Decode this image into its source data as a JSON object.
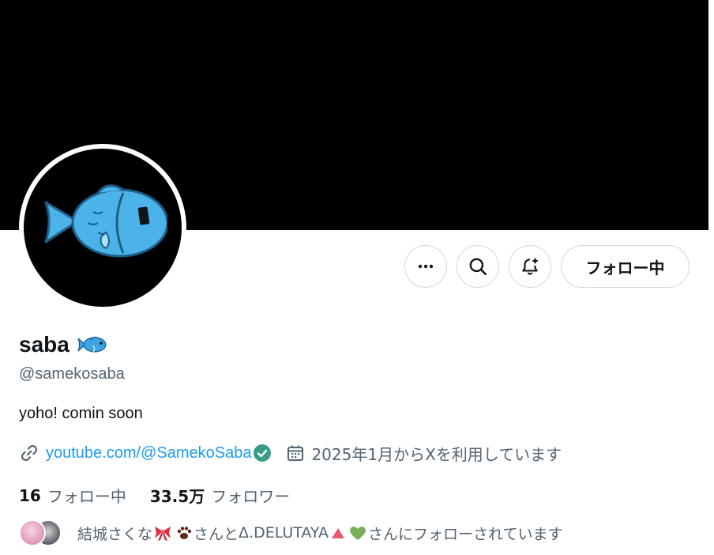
{
  "profile": {
    "display_name": "saba",
    "name_emoji_icon": "fish-emoji-icon",
    "handle": "@samekosaba",
    "bio": "yoho! comin soon",
    "link_text": "youtube.com/@SamekoSaba",
    "joined_text": "2025年1月からXを利用しています"
  },
  "actions": {
    "more_icon": "ellipsis-icon",
    "search_icon": "search-icon",
    "notify_icon": "bell-plus-icon",
    "follow_label": "フォロー中"
  },
  "stats": {
    "following_count": "16",
    "following_label": "フォロー中",
    "followers_count": "33.5万",
    "followers_label": "フォロワー"
  },
  "followed_by": {
    "name1": "結城さくな",
    "name1_emojis": [
      "ribbon-icon",
      "paw-icon"
    ],
    "connector": "さんと",
    "name2": "Δ.DELUTAYA",
    "name2_emojis": [
      "triangle-icon",
      "green-heart-icon"
    ],
    "suffix": "さんにフォローされています"
  },
  "colors": {
    "banner": "#000000",
    "link": "#1d9bf0",
    "secondary_text": "#536471",
    "primary_text": "#0f1419",
    "verified_badge": "#3a9b8a",
    "fish": "#4bb3ea"
  }
}
